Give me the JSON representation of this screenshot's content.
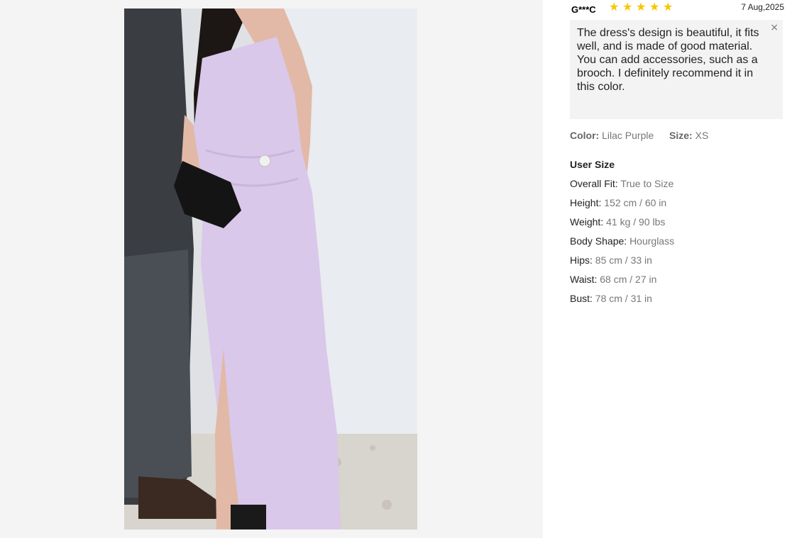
{
  "review": {
    "reviewer": "G***C",
    "rating": 5,
    "date": "7 Aug,2025",
    "text": "The dress's design is beautiful, it fits well, and is made of good material. You can add accessories, such as a brooch. I definitely recommend it in this color.",
    "close_icon": "×"
  },
  "product_attrs": {
    "color_label": "Color:",
    "color_value": "Lilac Purple",
    "size_label": "Size:",
    "size_value": "XS"
  },
  "user_size": {
    "title": "User Size",
    "rows": [
      {
        "label": "Overall Fit:",
        "value": "True to Size"
      },
      {
        "label": "Height:",
        "value": "152 cm / 60 in"
      },
      {
        "label": "Weight:",
        "value": "41 kg / 90 lbs"
      },
      {
        "label": "Body Shape:",
        "value": "Hourglass"
      },
      {
        "label": "Hips:",
        "value": "85 cm / 33 in"
      },
      {
        "label": "Waist:",
        "value": "68 cm / 27 in"
      },
      {
        "label": "Bust:",
        "value": "78 cm / 31 in"
      }
    ]
  },
  "colors": {
    "star": "#f7c600",
    "dress": "#d9c8ea",
    "review_bg": "#f3f3f3",
    "left_bg": "#f4f4f4"
  }
}
